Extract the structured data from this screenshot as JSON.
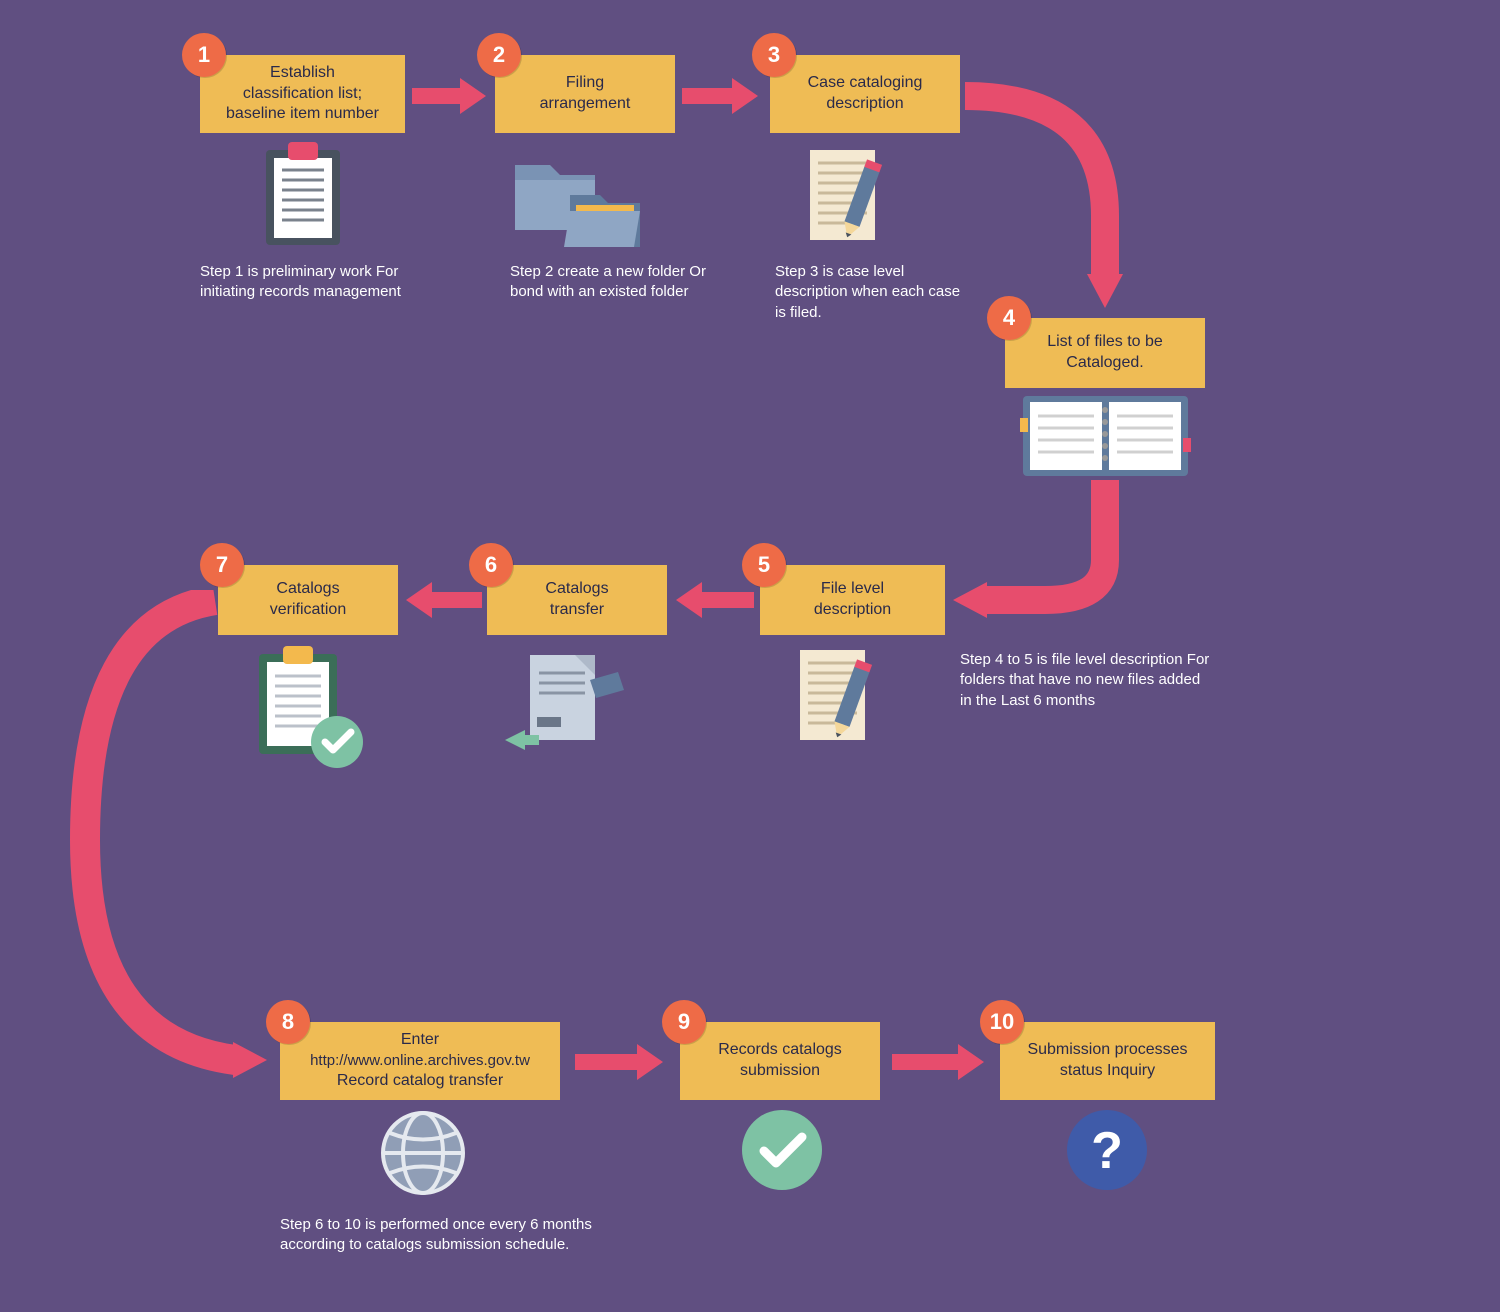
{
  "steps": {
    "s1": {
      "num": "1",
      "title_l1": "Establish",
      "title_l2": "classification list;",
      "title_l3": "baseline item number",
      "desc": "Step 1 is preliminary work For initiating records management"
    },
    "s2": {
      "num": "2",
      "title_l1": "Filing",
      "title_l2": "arrangement",
      "desc": "Step 2 create a new folder Or bond with an existed folder"
    },
    "s3": {
      "num": "3",
      "title_l1": "Case cataloging",
      "title_l2": "description",
      "desc": "Step 3 is case level description when each case is filed."
    },
    "s4": {
      "num": "4",
      "title_l1": "List of files to be",
      "title_l2": "Cataloged."
    },
    "s5": {
      "num": "5",
      "title_l1": "File level",
      "title_l2": "description",
      "desc": "Step 4 to 5 is file level description For folders that have no new files added in the Last 6 months"
    },
    "s6": {
      "num": "6",
      "title_l1": "Catalogs",
      "title_l2": "transfer"
    },
    "s7": {
      "num": "7",
      "title_l1": "Catalogs",
      "title_l2": "verification"
    },
    "s8": {
      "num": "8",
      "title_l1": "Enter",
      "title_l2": "http://www.online.archives.gov.tw",
      "title_l3": "Record catalog transfer",
      "desc": "Step 6 to 10 is performed once every 6 months according to catalogs submission schedule."
    },
    "s9": {
      "num": "9",
      "title_l1": "Records catalogs",
      "title_l2": "submission"
    },
    "s10": {
      "num": "10",
      "title_l1": "Submission processes",
      "title_l2": "status Inquiry"
    }
  },
  "colors": {
    "box": "#efbc55",
    "num": "#ee6b47",
    "arrow": "#e74d6d",
    "bg": "#604f81",
    "check": "#7ec2a4",
    "blue": "#3f5ba9",
    "slate": "#909eb6"
  }
}
